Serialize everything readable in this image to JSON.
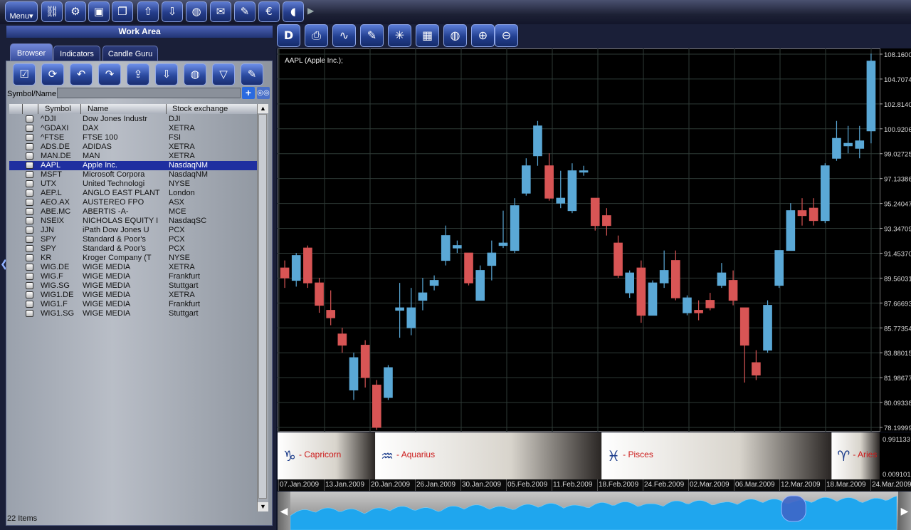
{
  "menu": {
    "label": "Menu"
  },
  "toolbar": {
    "icons": [
      "network-icon",
      "settings-gear-icon",
      "monitor-icon",
      "windows-icon",
      "upload-icon",
      "download-icon",
      "globe-icon",
      "mail-icon",
      "mail-send-icon",
      "euro-icon",
      "speaker-icon"
    ]
  },
  "work_area": {
    "title": "Work Area"
  },
  "tabs": {
    "browser": "Browser",
    "indicators": "Indicators",
    "candle_guru": "Candle Guru"
  },
  "browser": {
    "symbol_label": "Symbol/Name:",
    "symbol_value": "",
    "headers": {
      "symbol": "Symbol",
      "name": "Name",
      "exchange": "Stock exchange"
    },
    "rows": [
      {
        "symbol": "^DJI",
        "name": "Dow Jones Industr",
        "exchange": "DJI"
      },
      {
        "symbol": "^GDAXI",
        "name": "DAX",
        "exchange": "XETRA"
      },
      {
        "symbol": "^FTSE",
        "name": "FTSE 100",
        "exchange": "FSI"
      },
      {
        "symbol": "ADS.DE",
        "name": "ADIDAS",
        "exchange": "XETRA"
      },
      {
        "symbol": "MAN.DE",
        "name": "MAN",
        "exchange": "XETRA"
      },
      {
        "symbol": "AAPL",
        "name": "Apple Inc.",
        "exchange": "NasdaqNM",
        "selected": true
      },
      {
        "symbol": "MSFT",
        "name": "Microsoft Corpora",
        "exchange": "NasdaqNM"
      },
      {
        "symbol": "UTX",
        "name": "United Technologi",
        "exchange": "NYSE"
      },
      {
        "symbol": "AEP.L",
        "name": "ANGLO EAST PLANT",
        "exchange": "London"
      },
      {
        "symbol": "AEO.AX",
        "name": "AUSTEREO FPO",
        "exchange": "ASX"
      },
      {
        "symbol": "ABE.MC",
        "name": "ABERTIS -A-",
        "exchange": "MCE"
      },
      {
        "symbol": "NSEIX",
        "name": "NICHOLAS EQUITY I",
        "exchange": "NasdaqSC"
      },
      {
        "symbol": "JJN",
        "name": "iPath Dow Jones U",
        "exchange": "PCX"
      },
      {
        "symbol": "SPY",
        "name": "Standard & Poor's",
        "exchange": "PCX"
      },
      {
        "symbol": "SPY",
        "name": "Standard & Poor's",
        "exchange": "PCX"
      },
      {
        "symbol": "KR",
        "name": "Kroger Company (T",
        "exchange": "NYSE"
      },
      {
        "symbol": "WIG.DE",
        "name": "WIGE MEDIA",
        "exchange": "XETRA"
      },
      {
        "symbol": "WIG.F",
        "name": "WIGE MEDIA",
        "exchange": "Frankfurt"
      },
      {
        "symbol": "WIG.SG",
        "name": "WIGE MEDIA",
        "exchange": "Stuttgart"
      },
      {
        "symbol": "WIG1.DE",
        "name": "WIGE MEDIA",
        "exchange": "XETRA"
      },
      {
        "symbol": "WIG1.F",
        "name": "WIGE MEDIA",
        "exchange": "Frankfurt"
      },
      {
        "symbol": "WIG1.SG",
        "name": "WIGE MEDIA",
        "exchange": "Stuttgart"
      }
    ],
    "items_count": "22 Items"
  },
  "chart_toolbar": {
    "icons": [
      "d-chart-icon",
      "printer-icon",
      "line-chart-icon",
      "draw-pen-icon",
      "cursor-star-icon",
      "grid-icon",
      "globe-icon",
      "zoom-in-icon",
      "zoom-out-icon"
    ]
  },
  "colors": {
    "bull": "#5aa8d6",
    "bear": "#d85555",
    "grid": "#2e3a36",
    "background": "#000000"
  },
  "chart_data": {
    "type": "candlestick",
    "title": "AAPL (Apple Inc.);",
    "ylim": [
      78.199997,
      108.16
    ],
    "y_ticks": [
      "108.16000",
      "104.70741",
      "102.81402",
      "100.92063",
      "99.027252",
      "97.133865",
      "95.240479",
      "93.347092",
      "91.453705",
      "89.560318",
      "87.666931",
      "85.773544",
      "83.880157",
      "81.986771",
      "80.093384",
      "78.199997"
    ],
    "x_ticks": [
      "07.Jan.2009",
      "13.Jan.2009",
      "20.Jan.2009",
      "26.Jan.2009",
      "30.Jan.2009",
      "05.Feb.2009",
      "11.Feb.2009",
      "18.Feb.2009",
      "24.Feb.2009",
      "02.Mar.2009",
      "06.Mar.2009",
      "12.Mar.2009",
      "18.Mar.2009",
      "24.Mar.2009"
    ],
    "candles": [
      {
        "o": 91.0,
        "c": 90.2,
        "h": 91.6,
        "l": 89.4
      },
      {
        "o": 90.0,
        "c": 92.0,
        "h": 92.2,
        "l": 89.5
      },
      {
        "o": 92.6,
        "c": 89.8,
        "h": 92.8,
        "l": 89.4
      },
      {
        "o": 89.8,
        "c": 88.0,
        "h": 90.2,
        "l": 87.4
      },
      {
        "o": 87.6,
        "c": 87.0,
        "h": 89.2,
        "l": 86.4
      },
      {
        "o": 85.7,
        "c": 84.8,
        "h": 86.2,
        "l": 84.2
      },
      {
        "o": 81.2,
        "c": 83.8,
        "h": 84.2,
        "l": 80.4
      },
      {
        "o": 84.8,
        "c": 82.2,
        "h": 85.2,
        "l": 81.4
      },
      {
        "o": 81.6,
        "c": 78.2,
        "h": 82.0,
        "l": 78.0
      },
      {
        "o": 80.6,
        "c": 83.0,
        "h": 83.2,
        "l": 80.4
      },
      {
        "o": 87.6,
        "c": 87.8,
        "h": 89.8,
        "l": 85.4
      },
      {
        "o": 86.2,
        "c": 87.8,
        "h": 89.4,
        "l": 85.6
      },
      {
        "o": 88.4,
        "c": 89.0,
        "h": 90.2,
        "l": 87.6
      },
      {
        "o": 89.6,
        "c": 90.0,
        "h": 90.4,
        "l": 89.2
      },
      {
        "o": 91.6,
        "c": 93.6,
        "h": 94.4,
        "l": 91.2
      },
      {
        "o": 92.6,
        "c": 92.8,
        "h": 93.2,
        "l": 92.2
      },
      {
        "o": 92.2,
        "c": 89.8,
        "h": 92.2,
        "l": 89.6
      },
      {
        "o": 88.4,
        "c": 90.8,
        "h": 91.2,
        "l": 88.4
      },
      {
        "o": 91.2,
        "c": 92.2,
        "h": 93.2,
        "l": 90.0
      },
      {
        "o": 92.8,
        "c": 93.0,
        "h": 95.6,
        "l": 92.6
      },
      {
        "o": 92.4,
        "c": 96.0,
        "h": 96.6,
        "l": 92.2
      },
      {
        "o": 97.0,
        "c": 99.2,
        "h": 99.8,
        "l": 96.8
      },
      {
        "o": 100.0,
        "c": 102.4,
        "h": 102.8,
        "l": 99.2
      },
      {
        "o": 99.2,
        "c": 96.6,
        "h": 100.2,
        "l": 96.4
      },
      {
        "o": 96.2,
        "c": 96.6,
        "h": 98.8,
        "l": 95.8
      },
      {
        "o": 95.6,
        "c": 98.8,
        "h": 99.4,
        "l": 95.4
      },
      {
        "o": 98.8,
        "c": 98.8,
        "h": 99.2,
        "l": 98.4
      },
      {
        "o": 96.6,
        "c": 94.4,
        "h": 96.6,
        "l": 94.0
      },
      {
        "o": 95.2,
        "c": 94.4,
        "h": 95.8,
        "l": 93.6
      },
      {
        "o": 93.0,
        "c": 90.4,
        "h": 93.6,
        "l": 90.2
      },
      {
        "o": 89.0,
        "c": 90.6,
        "h": 90.8,
        "l": 88.6
      },
      {
        "o": 91.0,
        "c": 87.2,
        "h": 91.6,
        "l": 86.6
      },
      {
        "o": 87.2,
        "c": 89.8,
        "h": 90.0,
        "l": 87.2
      },
      {
        "o": 89.8,
        "c": 90.8,
        "h": 92.4,
        "l": 89.4
      },
      {
        "o": 91.6,
        "c": 88.6,
        "h": 92.4,
        "l": 88.4
      },
      {
        "o": 87.4,
        "c": 88.6,
        "h": 88.8,
        "l": 87.2
      },
      {
        "o": 87.6,
        "c": 87.4,
        "h": 88.4,
        "l": 86.8
      },
      {
        "o": 88.4,
        "c": 87.8,
        "h": 89.0,
        "l": 87.6
      },
      {
        "o": 89.6,
        "c": 90.6,
        "h": 91.4,
        "l": 89.4
      },
      {
        "o": 90.0,
        "c": 88.4,
        "h": 90.8,
        "l": 88.0
      },
      {
        "o": 87.8,
        "c": 84.8,
        "h": 87.8,
        "l": 81.8
      },
      {
        "o": 83.4,
        "c": 82.4,
        "h": 84.4,
        "l": 82.0
      },
      {
        "o": 84.4,
        "c": 88.0,
        "h": 88.4,
        "l": 84.2
      },
      {
        "o": 89.6,
        "c": 92.4,
        "h": 92.4,
        "l": 89.4
      },
      {
        "o": 92.4,
        "c": 95.6,
        "h": 96.2,
        "l": 92.4
      },
      {
        "o": 95.6,
        "c": 95.2,
        "h": 96.6,
        "l": 94.4
      },
      {
        "o": 95.8,
        "c": 94.8,
        "h": 96.6,
        "l": 94.4
      },
      {
        "o": 94.8,
        "c": 99.2,
        "h": 99.4,
        "l": 94.6
      },
      {
        "o": 99.8,
        "c": 101.4,
        "h": 102.8,
        "l": 99.6
      },
      {
        "o": 100.8,
        "c": 101.0,
        "h": 102.4,
        "l": 100.2
      },
      {
        "o": 100.6,
        "c": 101.2,
        "h": 102.4,
        "l": 99.8
      },
      {
        "o": 102.0,
        "c": 107.6,
        "h": 108.2,
        "l": 101.0
      }
    ]
  },
  "zodiac": {
    "segments": [
      {
        "symbol": "♑",
        "label": " - Capricorn",
        "from": 0.0,
        "to": 0.162
      },
      {
        "symbol": "♒",
        "label": " - Aquarius",
        "from": 0.162,
        "to": 0.538
      },
      {
        "symbol": "♓",
        "label": " - Pisces",
        "from": 0.538,
        "to": 0.92
      },
      {
        "symbol": "♈",
        "label": " - Aries",
        "from": 0.92,
        "to": 1.0
      }
    ],
    "axis_top": "0.991133",
    "axis_bottom": "0.009101"
  },
  "overview": {
    "left_arrow": "◀",
    "right_arrow": "▶",
    "window_from": 0.81,
    "window_to": 0.85
  }
}
